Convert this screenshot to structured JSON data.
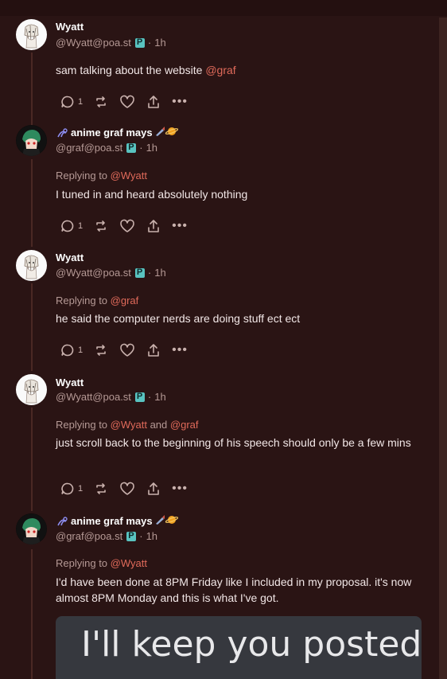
{
  "posts": [
    {
      "display_name": "Wyatt",
      "handle": "@Wyatt@poa.st",
      "time": "1h",
      "replying_prefix": "",
      "replying_to": [],
      "content": "sam talking about the website ",
      "content_mention": "@graf",
      "reply_count": "1"
    },
    {
      "display_name": "anime graf mays",
      "handle": "@graf@poa.st",
      "time": "1h",
      "replying_prefix": "Replying to ",
      "replying_to": [
        "@Wyatt"
      ],
      "content": "I tuned in and heard absolutely nothing",
      "reply_count": "1"
    },
    {
      "display_name": "Wyatt",
      "handle": "@Wyatt@poa.st",
      "time": "1h",
      "replying_prefix": "Replying to ",
      "replying_to": [
        "@graf"
      ],
      "content": "he said the computer nerds are doing stuff ect ect",
      "reply_count": "1"
    },
    {
      "display_name": "Wyatt",
      "handle": "@Wyatt@poa.st",
      "time": "1h",
      "replying_prefix": "Replying to ",
      "replying_to": [
        "@Wyatt",
        "@graf"
      ],
      "replying_joiner": " and ",
      "content": "just scroll back to the beginning of his speech should only be a few mins",
      "reply_count": "1"
    },
    {
      "display_name": "anime graf mays",
      "handle": "@graf@poa.st",
      "time": "1h",
      "replying_prefix": "Replying to ",
      "replying_to": [
        "@Wyatt"
      ],
      "content": "I'd have been done at 8PM Friday like I included in my proposal. it's now almost 8PM Monday and this is what I've got.",
      "attachment_text": "I'll keep you posted"
    }
  ],
  "separator": "·",
  "icons": {
    "reply": "reply-icon",
    "repost": "repost-icon",
    "like": "heart-icon",
    "share": "share-icon",
    "more": "more-icon",
    "instance": "instance-badge-icon",
    "name_prefix": "emoji-icon",
    "name_suffix": "rocket-planet-emoji-icon"
  },
  "colors": {
    "background": "#2a1414",
    "mention": "#e06a5a",
    "muted": "#b59995",
    "badge": "#59c3c0"
  }
}
